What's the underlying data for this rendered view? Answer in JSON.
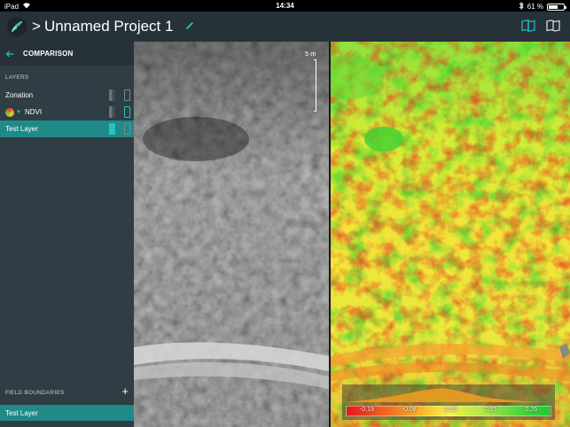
{
  "statusbar": {
    "device": "iPad",
    "time": "14:34",
    "battery_text": "61 %",
    "battery_level": 0.61
  },
  "header": {
    "title_prefix": ">",
    "title": "Unnamed Project 1"
  },
  "sidebar": {
    "title": "COMPARISON",
    "layers_label": "LAYERS",
    "layers": [
      {
        "label": "Zonation"
      },
      {
        "label": "NDVI"
      },
      {
        "label": "Test Layer"
      }
    ],
    "field_boundaries_label": "FIELD BOUNDARIES",
    "field_boundary_layer": "Test Layer"
  },
  "map": {
    "scale_label": "5 m"
  },
  "legend": {
    "ticks": [
      "-0,19",
      "-0,08",
      "0,03",
      "0,15",
      "0,26"
    ]
  },
  "colors": {
    "accent": "#26b5b2",
    "header_bg": "#263238",
    "sidebar_bg": "#2f3d44",
    "active_row": "#1f8a88"
  }
}
